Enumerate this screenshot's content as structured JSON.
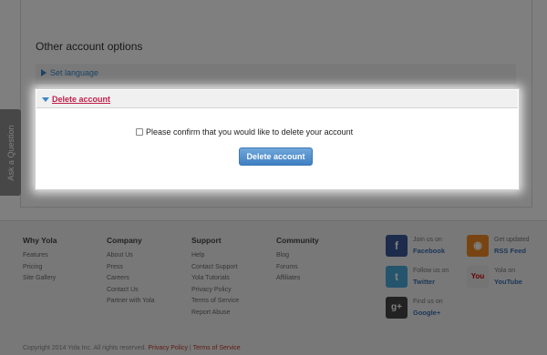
{
  "section": {
    "title": "Other account options"
  },
  "accordion": {
    "set_language": "Set language",
    "delete_account": "Delete account"
  },
  "side_tab": {
    "label": "Ask a Question"
  },
  "modal": {
    "confirm_text": "Please confirm that you would like to delete your account",
    "confirm_checked": false,
    "button_label": "Delete account"
  },
  "footer": {
    "columns": [
      {
        "title": "Why Yola",
        "links": [
          "Features",
          "Pricing",
          "Site Gallery"
        ]
      },
      {
        "title": "Company",
        "links": [
          "About Us",
          "Press",
          "Careers",
          "Contact Us",
          "Partner with Yola"
        ]
      },
      {
        "title": "Support",
        "links": [
          "Help",
          "Contact Support",
          "Yola Tutorials",
          "Privacy Policy",
          "Terms of Service",
          "Report Abuse"
        ]
      },
      {
        "title": "Community",
        "links": [
          "Blog",
          "Forums",
          "Affiliates"
        ]
      }
    ],
    "social": [
      {
        "icon": "facebook-icon",
        "line1": "Join us on",
        "line2": "Facebook",
        "color": "#3b5998",
        "glyph": "f"
      },
      {
        "icon": "twitter-icon",
        "line1": "Follow us on",
        "line2": "Twitter",
        "color": "#4aa8db",
        "glyph": "t"
      },
      {
        "icon": "google-plus-icon",
        "line1": "Find us on",
        "line2": "Google+",
        "color": "#444444",
        "glyph": "g+"
      },
      {
        "icon": "rss-icon",
        "line1": "Get updated",
        "line2": "RSS Feed",
        "color": "#f08a24",
        "glyph": "◉"
      },
      {
        "icon": "youtube-icon",
        "line1": "Yola on",
        "line2": "YouTube",
        "color": "#e8e8e8",
        "glyph": "You"
      }
    ],
    "copyright": "Copyright 2014 Yola Inc. All rights reserved.",
    "privacy_link": "Privacy Policy",
    "separator": "|",
    "terms_link": "Terms of Service"
  },
  "colors": {
    "accent": "#3a87c8",
    "delete_label": "#c0214a",
    "button": "#4a8ad0",
    "overlay": "rgba(0,0,0,0.5)"
  }
}
